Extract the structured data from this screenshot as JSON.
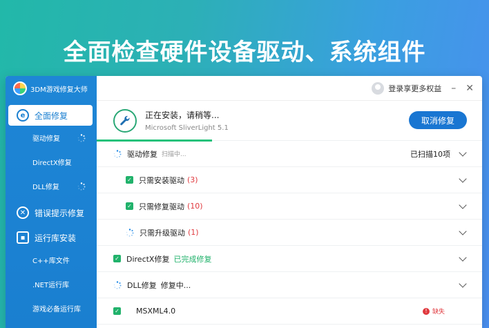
{
  "headline": "全面检查硬件设备驱动、系统组件",
  "app": {
    "title": "3DM游戏修复大师"
  },
  "titlebar": {
    "login_text": "登录享更多权益",
    "minimize": "–",
    "close": "✕"
  },
  "sidebar": {
    "full_repair": "全面修复",
    "driver_repair": "驱动修复",
    "directx_repair": "DirectX修复",
    "dll_repair": "DLL修复",
    "error_repair": "错误提示修复",
    "runtime_install": "运行库安装",
    "cpp_lib": "C++库文件",
    "net_runtime": ".NET运行库",
    "game_runtime": "游戏必备运行库"
  },
  "status": {
    "installing": "正在安装，请稍等...",
    "component": "Microsoft SliverLight 5.1",
    "cancel_label": "取消修复",
    "progress_fraction": 0.3
  },
  "rows": {
    "driver": {
      "label": "驱动修复",
      "sub": "扫描中...",
      "right": "已扫描10项"
    },
    "install_only": {
      "label": "只需安装驱动",
      "count": "(3)"
    },
    "repair_only": {
      "label": "只需修复驱动",
      "count": "(10)"
    },
    "upgrade_only": {
      "label": "只需升级驱动",
      "count": "(1)"
    },
    "directx": {
      "label": "DirectX修复",
      "status": "已完成修复"
    },
    "dll": {
      "label": "DLL修复",
      "status": "修复中..."
    },
    "msxml": {
      "label": "MSXML4.0",
      "missing": "缺失"
    }
  },
  "colors": {
    "accent": "#1976d2",
    "success": "#21b26b",
    "danger": "#e0393e"
  }
}
